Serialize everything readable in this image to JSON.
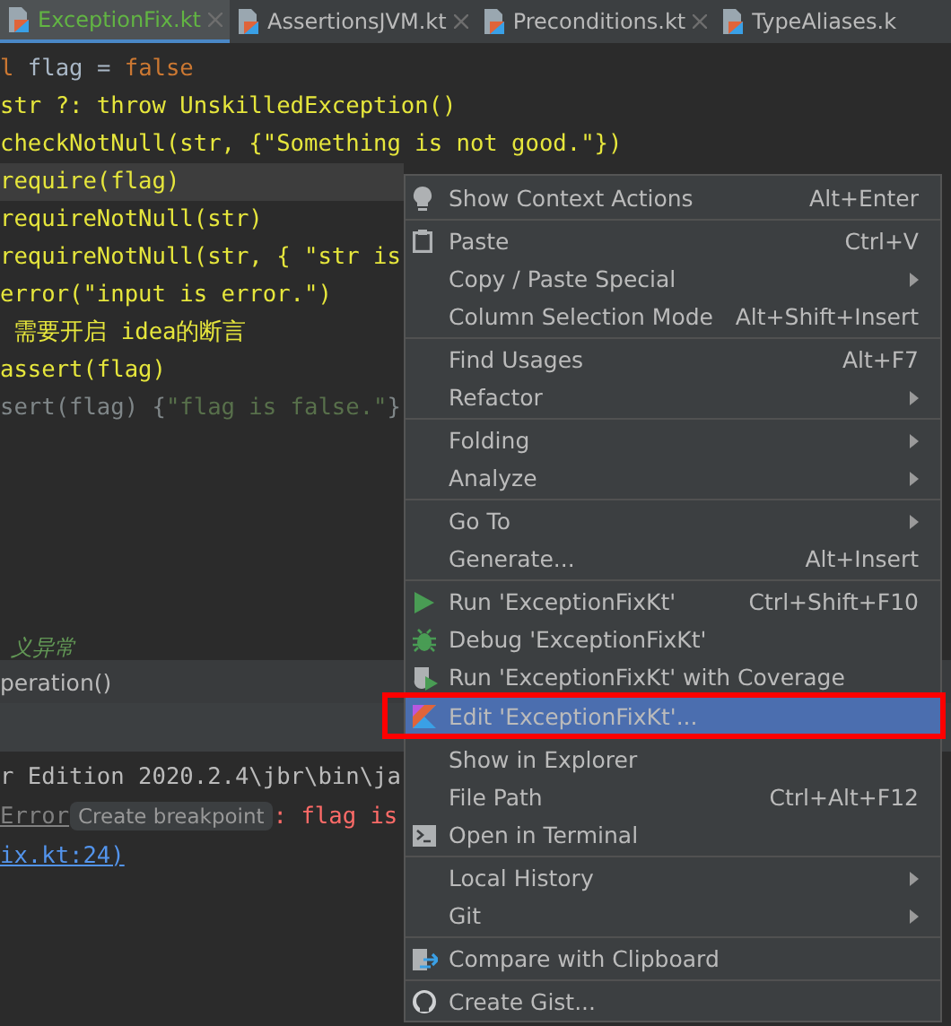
{
  "tabs": [
    {
      "label": "ExceptionFix.kt",
      "selected": true,
      "closable": true
    },
    {
      "label": "AssertionsJVM.kt",
      "selected": false,
      "closable": true
    },
    {
      "label": "Preconditions.kt",
      "selected": false,
      "closable": true
    },
    {
      "label": "TypeAliases.k",
      "selected": false,
      "closable": false
    }
  ],
  "code_lines": [
    {
      "current": false,
      "segments": [
        {
          "text": "l",
          "kind": "keyword"
        },
        {
          "text": " flag = ",
          "kind": "plain"
        },
        {
          "text": "false",
          "kind": "keyword"
        }
      ]
    },
    {
      "current": false,
      "segments": [
        {
          "text": "str ?: throw UnskilledException()",
          "kind": "marked"
        }
      ]
    },
    {
      "current": false,
      "segments": [
        {
          "text": "checkNotNull(str, {\"Something is not good.\"})",
          "kind": "marked"
        }
      ]
    },
    {
      "current": true,
      "segments": [
        {
          "text": "require(flag)",
          "kind": "marked"
        }
      ]
    },
    {
      "current": false,
      "segments": [
        {
          "text": "requireNotNull(str)",
          "kind": "marked"
        }
      ]
    },
    {
      "current": false,
      "segments": [
        {
          "text": "requireNotNull(str, { \"str is",
          "kind": "marked"
        }
      ]
    },
    {
      "current": false,
      "segments": [
        {
          "text": "error(\"input is error.\")",
          "kind": "marked"
        }
      ]
    },
    {
      "current": false,
      "segments": [
        {
          "text": " 需要开启 idea的断言",
          "kind": "marked"
        }
      ]
    },
    {
      "current": false,
      "segments": [
        {
          "text": "assert(flag)",
          "kind": "marked"
        }
      ]
    },
    {
      "current": false,
      "segments": [
        {
          "text": "sert(flag) {",
          "kind": "dim"
        },
        {
          "text": "\"flag is false.\"",
          "kind": "dimstring"
        },
        {
          "text": "}",
          "kind": "dim"
        }
      ]
    }
  ],
  "comment_fragment": "义异常",
  "breadcrumb": "peration()",
  "console": {
    "path_line": "r Edition 2020.2.4\\jbr\\bin\\ja",
    "error_word": "Error",
    "tooltip": "Create breakpoint",
    "message": ": flag is",
    "link": "ix.kt:24)"
  },
  "context_menu": [
    {
      "kind": "item",
      "label": "Show Context Actions",
      "shortcut": "Alt+Enter",
      "submenu": false,
      "selected": false
    },
    {
      "kind": "separator"
    },
    {
      "kind": "item",
      "label": "Paste",
      "shortcut": "Ctrl+V",
      "submenu": false,
      "selected": false
    },
    {
      "kind": "item",
      "label": "Copy / Paste Special",
      "submenu": true,
      "selected": false
    },
    {
      "kind": "item",
      "label": "Column Selection Mode",
      "shortcut": "Alt+Shift+Insert",
      "submenu": false,
      "selected": false
    },
    {
      "kind": "separator"
    },
    {
      "kind": "item",
      "label": "Find Usages",
      "shortcut": "Alt+F7",
      "submenu": false,
      "selected": false
    },
    {
      "kind": "item",
      "label": "Refactor",
      "submenu": true,
      "selected": false
    },
    {
      "kind": "separator"
    },
    {
      "kind": "item",
      "label": "Folding",
      "submenu": true,
      "selected": false
    },
    {
      "kind": "item",
      "label": "Analyze",
      "submenu": true,
      "selected": false
    },
    {
      "kind": "separator"
    },
    {
      "kind": "item",
      "label": "Go To",
      "submenu": true,
      "selected": false
    },
    {
      "kind": "item",
      "label": "Generate...",
      "shortcut": "Alt+Insert",
      "submenu": false,
      "selected": false
    },
    {
      "kind": "separator"
    },
    {
      "kind": "item",
      "label": "Run 'ExceptionFixKt'",
      "shortcut": "Ctrl+Shift+F10",
      "submenu": false,
      "selected": false
    },
    {
      "kind": "item",
      "label": "Debug 'ExceptionFixKt'",
      "submenu": false,
      "selected": false
    },
    {
      "kind": "item",
      "label": "Run 'ExceptionFixKt' with Coverage",
      "submenu": false,
      "selected": false
    },
    {
      "kind": "item",
      "label": "Edit 'ExceptionFixKt'...",
      "submenu": false,
      "selected": true,
      "outlined": true
    },
    {
      "kind": "item",
      "label": "Show in Explorer",
      "submenu": false,
      "selected": false
    },
    {
      "kind": "item",
      "label": "File Path",
      "shortcut": "Ctrl+Alt+F12",
      "submenu": false,
      "selected": false
    },
    {
      "kind": "item",
      "label": "Open in Terminal",
      "submenu": false,
      "selected": false
    },
    {
      "kind": "separator"
    },
    {
      "kind": "item",
      "label": "Local History",
      "submenu": true,
      "selected": false
    },
    {
      "kind": "item",
      "label": "Git",
      "submenu": true,
      "selected": false
    },
    {
      "kind": "separator"
    },
    {
      "kind": "item",
      "label": "Compare with Clipboard",
      "submenu": false,
      "selected": false
    },
    {
      "kind": "separator"
    },
    {
      "kind": "item",
      "label": "Create Gist...",
      "submenu": false,
      "selected": false
    }
  ]
}
